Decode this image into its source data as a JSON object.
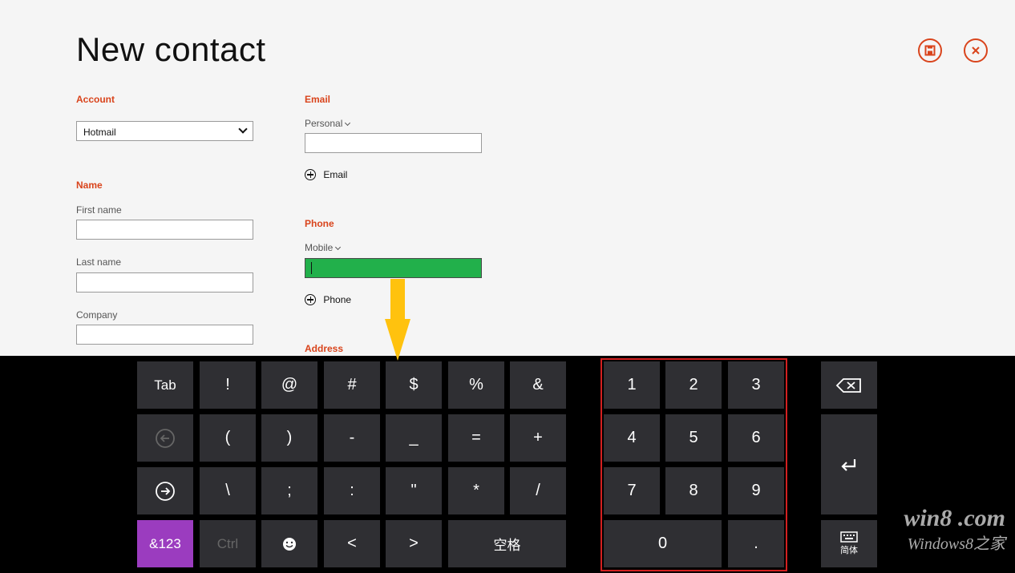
{
  "header": {
    "title": "New contact"
  },
  "account": {
    "label": "Account",
    "value": "Hotmail"
  },
  "name": {
    "label": "Name",
    "first_name_label": "First name",
    "last_name_label": "Last name",
    "company_label": "Company"
  },
  "email": {
    "label": "Email",
    "type_label": "Personal",
    "add_label": "Email"
  },
  "phone": {
    "label": "Phone",
    "type_label": "Mobile",
    "add_label": "Phone",
    "active_color": "#22b04b"
  },
  "address": {
    "label": "Address"
  },
  "keyboard": {
    "row1": [
      "Tab",
      "!",
      "@",
      "#",
      "$",
      "%",
      "&"
    ],
    "row2": [
      "(",
      ")",
      "-",
      "_",
      "=",
      "+"
    ],
    "row3": [
      "\\",
      ";",
      ":",
      "\"",
      "*",
      "/"
    ],
    "row4": {
      "mode": "&123",
      "ctrl": "Ctrl",
      "lt": "<",
      "gt": ">",
      "space": "空格"
    },
    "numpad": [
      "1",
      "2",
      "3",
      "4",
      "5",
      "6",
      "7",
      "8",
      "9",
      "0",
      "."
    ],
    "lang_label": "简体"
  },
  "watermark": {
    "line1": "win8 .com",
    "line2": "Windows8之家"
  },
  "colors": {
    "accent": "#d9441c",
    "key_bg": "#2f2f33",
    "mode_key": "#9b3cbf",
    "highlight": "#d32020",
    "arrow": "#ffc20e"
  }
}
